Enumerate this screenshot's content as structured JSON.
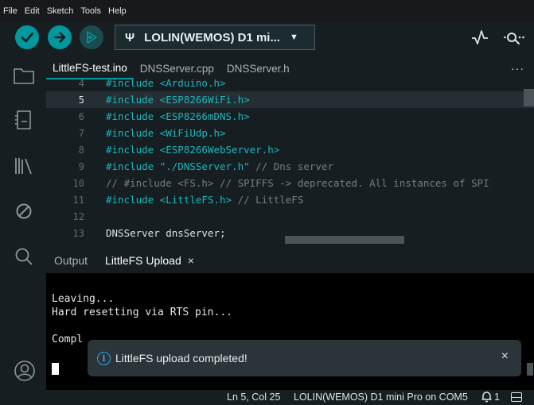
{
  "menu": [
    "File",
    "Edit",
    "Sketch",
    "Tools",
    "Help"
  ],
  "toolbar": {
    "board": "LOLIN(WEMOS) D1 mi...",
    "icons": [
      "verify-icon",
      "upload-icon",
      "debug-icon",
      "usb-icon",
      "serial-plotter-icon",
      "serial-monitor-icon"
    ]
  },
  "tabs": [
    {
      "label": "LittleFS-test.ino",
      "active": true
    },
    {
      "label": "DNSServer.cpp",
      "active": false
    },
    {
      "label": "DNSServer.h",
      "active": false
    }
  ],
  "tabs_more": "···",
  "editor": {
    "lines": [
      {
        "num": "4",
        "tokens": [
          [
            "kw",
            "#include "
          ],
          [
            "st",
            "<Arduino.h>"
          ]
        ]
      },
      {
        "num": "5",
        "tokens": [
          [
            "kw",
            "#include "
          ],
          [
            "st",
            "<ESP8266WiFi.h>"
          ]
        ]
      },
      {
        "num": "6",
        "tokens": [
          [
            "kw",
            "#include "
          ],
          [
            "st",
            "<ESP8266mDNS.h>"
          ]
        ]
      },
      {
        "num": "7",
        "tokens": [
          [
            "kw",
            "#include "
          ],
          [
            "st",
            "<WiFiUdp.h>"
          ]
        ]
      },
      {
        "num": "8",
        "tokens": [
          [
            "kw",
            "#include "
          ],
          [
            "st",
            "<ESP8266WebServer.h>"
          ]
        ]
      },
      {
        "num": "9",
        "tokens": [
          [
            "kw",
            "#include "
          ],
          [
            "st",
            "\"./DNSServer.h\""
          ],
          [
            "cm",
            " // Dns server"
          ]
        ]
      },
      {
        "num": "10",
        "tokens": [
          [
            "cm",
            "// #include <FS.h> // SPIFFS -> deprecated. All instances of SPI"
          ]
        ]
      },
      {
        "num": "11",
        "tokens": [
          [
            "kw",
            "#include "
          ],
          [
            "st",
            "<LittleFS.h>"
          ],
          [
            "cm",
            " // LittleFS"
          ]
        ]
      },
      {
        "num": "12",
        "tokens": []
      },
      {
        "num": "13",
        "tokens": [
          [
            "pl",
            "DNSServer dnsServer;"
          ]
        ]
      }
    ],
    "current_line": "5"
  },
  "output": {
    "tabs": [
      "Output",
      "LittleFS Upload"
    ],
    "close": "×",
    "lines": [
      "Leaving...",
      "Hard resetting via RTS pin...",
      "",
      "Compl"
    ]
  },
  "toast": {
    "message": "LittleFS upload completed!",
    "close": "×"
  },
  "status": {
    "position": "Ln 5, Col 25",
    "board": "LOLIN(WEMOS) D1 mini Pro on COM5",
    "notifications": "1"
  }
}
